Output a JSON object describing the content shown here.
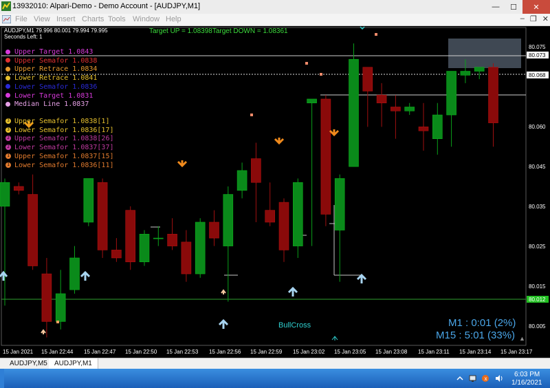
{
  "window": {
    "title": "13932010: Alpari-Demo - Demo Account - [AUDJPY,M1]",
    "menu": [
      "File",
      "View",
      "Insert",
      "Charts",
      "Tools",
      "Window",
      "Help"
    ]
  },
  "chart": {
    "symbol_info": "AUDJPY,M1  79.996 80.001 79.994 79.995",
    "seconds_left": "Seconds Left:  1",
    "target_up": "Target UP = 1.08398",
    "target_down": "Target DOWN = 1.08361",
    "price_axis": [
      "80.075",
      "80.073",
      "80.068",
      "80.060",
      "80.045",
      "80.035",
      "80.025",
      "80.015",
      "80.012",
      "80.005"
    ],
    "time_axis": [
      "15 Jan 2021",
      "15 Jan 22:44",
      "15 Jan 22:47",
      "15 Jan 22:50",
      "15 Jan 22:53",
      "15 Jan 22:56",
      "15 Jan 22:59",
      "15 Jan 23:02",
      "15 Jan 23:05",
      "15 Jan 23:08",
      "15 Jan 23:11",
      "15 Jan 23:14",
      "15 Jan 23:17"
    ],
    "bull_cross": "BullCross",
    "m1_timer": "M1 : 0:01 (2%)",
    "m15_timer": "M15 : 5:01 (33%)",
    "legend_lines": [
      {
        "label": "Upper Target  1.0843",
        "color": "#d83adb"
      },
      {
        "label": "Upper Semafor 1.0838",
        "color": "#e03030"
      },
      {
        "label": "Upper Retrace 1.0834",
        "color": "#e69a2e"
      },
      {
        "label": "Lower Retrace 1.0841",
        "color": "#e6c02e"
      },
      {
        "label": "Lower Semafor 1.0836",
        "color": "#2a2ad8"
      },
      {
        "label": "Lower Target  1.0831",
        "color": "#d83adb"
      },
      {
        "label": "Median Line   1.0837",
        "color": "#e6a0e6"
      }
    ],
    "semafor_lines": [
      {
        "num": "3",
        "label": "Upper Semafor 1.0838[1]",
        "color": "#e6c02e"
      },
      {
        "num": "3",
        "label": "Lower Semafor 1.0836[17]",
        "color": "#e6c02e"
      },
      {
        "num": "2",
        "label": "Upper Semafor 1.0838[26]",
        "color": "#c03aa0"
      },
      {
        "num": "2",
        "label": "Lower Semafor 1.0837[37]",
        "color": "#c03aa0"
      },
      {
        "num": "1",
        "label": "Upper Semafor 1.0837[15]",
        "color": "#e07a2e"
      },
      {
        "num": "1",
        "label": "Lower Semafor 1.0836[11]",
        "color": "#e07a2e"
      }
    ]
  },
  "chart_data": {
    "type": "candlestick",
    "ylim": [
      80.0,
      80.08
    ],
    "candles": [
      {
        "o": 80.035,
        "h": 80.042,
        "l": 80.01,
        "c": 80.041
      },
      {
        "o": 80.04,
        "h": 80.041,
        "l": 80.038,
        "c": 80.039
      },
      {
        "o": 80.038,
        "h": 80.043,
        "l": 80.019,
        "c": 80.02
      },
      {
        "o": 80.018,
        "h": 80.022,
        "l": 80.002,
        "c": 80.006
      },
      {
        "o": 80.006,
        "h": 80.019,
        "l": 80.004,
        "c": 80.013
      },
      {
        "o": 80.014,
        "h": 80.025,
        "l": 80.013,
        "c": 80.022
      },
      {
        "o": 80.031,
        "h": 80.038,
        "l": 80.03,
        "c": 80.042
      },
      {
        "o": 80.041,
        "h": 80.042,
        "l": 80.022,
        "c": 80.024
      },
      {
        "o": 80.024,
        "h": 80.027,
        "l": 80.021,
        "c": 80.022
      },
      {
        "o": 80.034,
        "h": 80.035,
        "l": 80.019,
        "c": 80.021
      },
      {
        "o": 80.021,
        "h": 80.029,
        "l": 80.02,
        "c": 80.028
      },
      {
        "o": 80.027,
        "h": 80.03,
        "l": 80.025,
        "c": 80.027
      },
      {
        "o": 80.028,
        "h": 80.032,
        "l": 80.024,
        "c": 80.025
      },
      {
        "o": 80.026,
        "h": 80.029,
        "l": 80.016,
        "c": 80.018
      },
      {
        "o": 80.018,
        "h": 80.032,
        "l": 80.017,
        "c": 80.031
      },
      {
        "o": 80.031,
        "h": 80.034,
        "l": 80.025,
        "c": 80.027
      },
      {
        "o": 80.025,
        "h": 80.04,
        "l": 80.011,
        "c": 80.038
      },
      {
        "o": 80.039,
        "h": 80.046,
        "l": 80.037,
        "c": 80.044
      },
      {
        "o": 80.047,
        "h": 80.051,
        "l": 80.031,
        "c": 80.041
      },
      {
        "o": 80.034,
        "h": 80.041,
        "l": 80.03,
        "c": 80.031
      },
      {
        "o": 80.036,
        "h": 80.037,
        "l": 80.021,
        "c": 80.024
      },
      {
        "o": 80.025,
        "h": 80.042,
        "l": 80.022,
        "c": 80.041
      },
      {
        "o": 80.061,
        "h": 80.062,
        "l": 80.025,
        "c": 80.062
      },
      {
        "o": 80.062,
        "h": 80.063,
        "l": 80.03,
        "c": 80.033
      },
      {
        "o": 80.029,
        "h": 80.043,
        "l": 80.016,
        "c": 80.042
      },
      {
        "o": 80.045,
        "h": 80.076,
        "l": 80.045,
        "c": 80.072
      },
      {
        "o": 80.07,
        "h": 80.07,
        "l": 80.055,
        "c": 80.064
      },
      {
        "o": 80.063,
        "h": 80.066,
        "l": 80.055,
        "c": 80.061
      },
      {
        "o": 80.06,
        "h": 80.063,
        "l": 80.052,
        "c": 80.059
      },
      {
        "o": 80.059,
        "h": 80.061,
        "l": 80.058,
        "c": 80.06
      },
      {
        "o": 80.055,
        "h": 80.061,
        "l": 80.049,
        "c": 80.054
      },
      {
        "o": 80.052,
        "h": 80.061,
        "l": 80.048,
        "c": 80.058
      },
      {
        "o": 80.058,
        "h": 80.069,
        "l": 80.05,
        "c": 80.069
      },
      {
        "o": 80.068,
        "h": 80.072,
        "l": 80.066,
        "c": 80.069
      },
      {
        "o": 80.069,
        "h": 80.07,
        "l": 80.067,
        "c": 80.07
      },
      {
        "o": 80.07,
        "h": 80.071,
        "l": 80.05,
        "c": 80.056
      }
    ]
  },
  "tabs": [
    "AUDJPY,M5",
    "AUDJPY,M1"
  ],
  "taskbar": {
    "time": "6:03 PM",
    "date": "1/16/2021"
  }
}
